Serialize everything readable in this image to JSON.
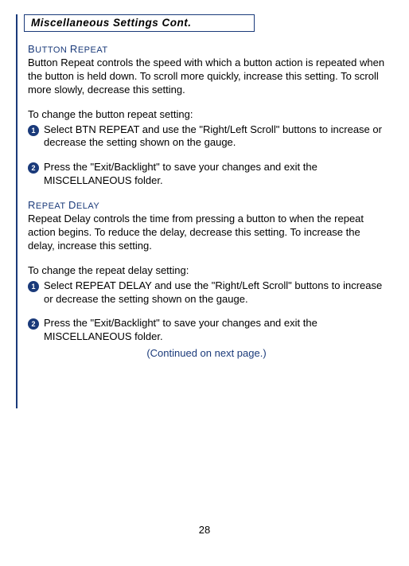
{
  "header": {
    "title": "Miscellaneous Settings Cont."
  },
  "sections": [
    {
      "heading_first": "B",
      "heading_rest1": "UTTON",
      "heading_first2": "R",
      "heading_rest2": "EPEAT",
      "body": "Button Repeat controls the speed with which a button action is repeated when the button is held down.  To scroll more quickly, increase this setting.  To scroll more slowly, decrease this setting.",
      "intro": "To change the button repeat setting:",
      "steps": [
        "Select BTN REPEAT and use the \"Right/Left Scroll\" buttons to increase or decrease the setting shown on the gauge.",
        "Press the \"Exit/Backlight\" to save your changes and exit the MISCELLANEOUS folder."
      ]
    },
    {
      "heading_first": "R",
      "heading_rest1": "EPEAT",
      "heading_first2": "D",
      "heading_rest2": "ELAY",
      "body": "Repeat Delay controls the time from pressing a button to when the repeat action begins.  To reduce the delay, decrease this setting.  To increase the delay, increase this setting.",
      "intro": "To change the repeat delay setting:",
      "steps": [
        "Select REPEAT DELAY and use the \"Right/Left Scroll\" buttons to increase or decrease the setting shown on the gauge.",
        "Press the \"Exit/Backlight\" to save your changes and exit the MISCELLANEOUS folder."
      ]
    }
  ],
  "continued": "(Continued on next page.)",
  "page_number": "28"
}
